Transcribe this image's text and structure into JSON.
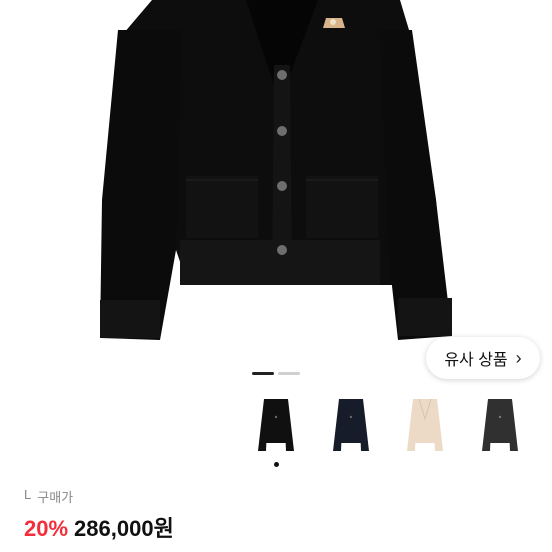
{
  "similar": {
    "label": "유사 상품",
    "chevron": "›"
  },
  "pager": {
    "count": 2,
    "active_index": 0
  },
  "thumbnails": [
    {
      "name": "black cardigan",
      "color": "#101010"
    },
    {
      "name": "navy cardigan",
      "color": "#171c2b"
    },
    {
      "name": "beige cardigan",
      "color": "#ecd9c6"
    },
    {
      "name": "charcoal cardigan",
      "color": "#303030"
    }
  ],
  "selected_thumbnail_index": 0,
  "product": {
    "size": "L",
    "status": "구매가",
    "discount": "20%",
    "price": "286,000원"
  }
}
